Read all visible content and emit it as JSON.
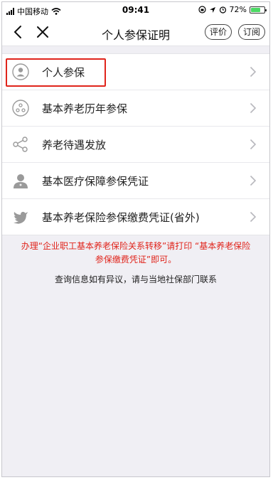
{
  "status_bar": {
    "carrier": "中国移动",
    "time": "09:41",
    "battery_percent": "72%",
    "battery_level": 0.72
  },
  "nav": {
    "title": "个人参保证明",
    "rate_label": "评价",
    "subscribe_label": "订阅"
  },
  "menu": {
    "items": [
      {
        "label": "个人参保",
        "icon": "person-icon"
      },
      {
        "label": "基本养老历年参保",
        "icon": "pension-history-icon"
      },
      {
        "label": "养老待遇发放",
        "icon": "share-icon"
      },
      {
        "label": "基本医疗保障参保凭证",
        "icon": "doctor-icon"
      },
      {
        "label": "基本养老保险参保缴费凭证(省外)",
        "icon": "bird-icon"
      }
    ]
  },
  "notice": {
    "line1": "办理“企业职工基本养老保险关系转移”请打印 “基本养老保险",
    "line2": "参保缴费凭证”即可。"
  },
  "info": {
    "text": "查询信息如有异议，请与当地社保部门联系"
  },
  "colors": {
    "highlight": "#e0241b",
    "notice": "#e0241b",
    "background": "#f0eff4",
    "battery": "#4cd964"
  }
}
